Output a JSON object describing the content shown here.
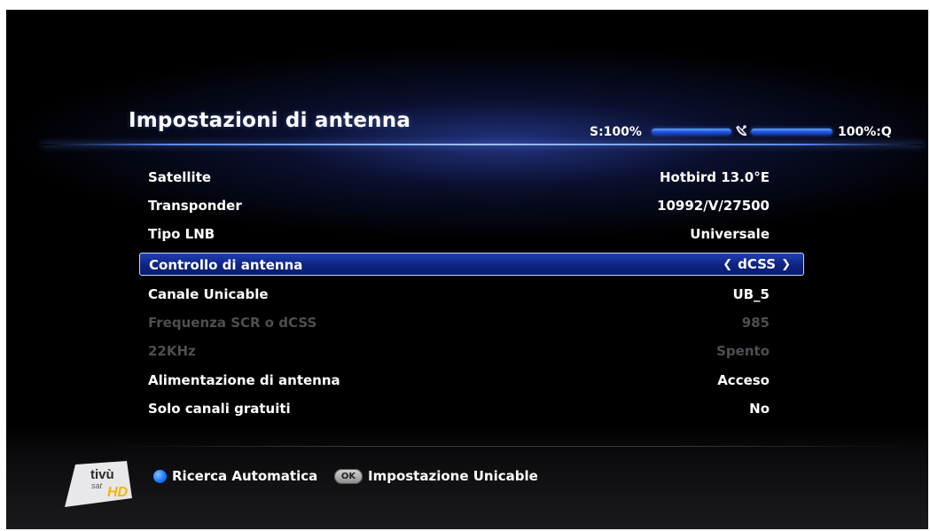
{
  "screen": {
    "title": "Impostazioni di antenna",
    "signal": {
      "strength_label": "S:100%",
      "quality_label": "100%:Q",
      "strength_level": 1.0,
      "quality_level": 1.0,
      "icon": "satellite-dish-icon"
    }
  },
  "menu": {
    "rows": [
      {
        "label": "Satellite",
        "value": "Hotbird 13.0°E",
        "state": "normal"
      },
      {
        "label": "Transponder",
        "value": "10992/V/27500",
        "state": "normal"
      },
      {
        "label": "Tipo LNB",
        "value": "Universale",
        "state": "normal"
      },
      {
        "label": "Controllo di antenna",
        "value": "dCSS",
        "state": "selected"
      },
      {
        "label": "Canale Unicable",
        "value": "UB_5",
        "state": "normal"
      },
      {
        "label": "Frequenza SCR o dCSS",
        "value": "985",
        "state": "disabled"
      },
      {
        "label": "22KHz",
        "value": "Spento",
        "state": "disabled"
      },
      {
        "label": "Alimentazione di antenna",
        "value": "Acceso",
        "state": "normal"
      },
      {
        "label": "Solo canali gratuiti",
        "value": "No",
        "state": "normal"
      }
    ],
    "selected_arrows": {
      "left": "❮",
      "right": "❯"
    }
  },
  "footer": {
    "logo": {
      "top": "tivù",
      "bottom": "sat",
      "badge": "HD"
    },
    "blue_button_label": "Ricerca Automatica",
    "ok_button_label": "OK",
    "ok_action_label": "Impostazione Unicable"
  },
  "colors": {
    "selection": "#0e2380",
    "accent": "#5c8cff",
    "disabled_text": "#4e4e54"
  }
}
